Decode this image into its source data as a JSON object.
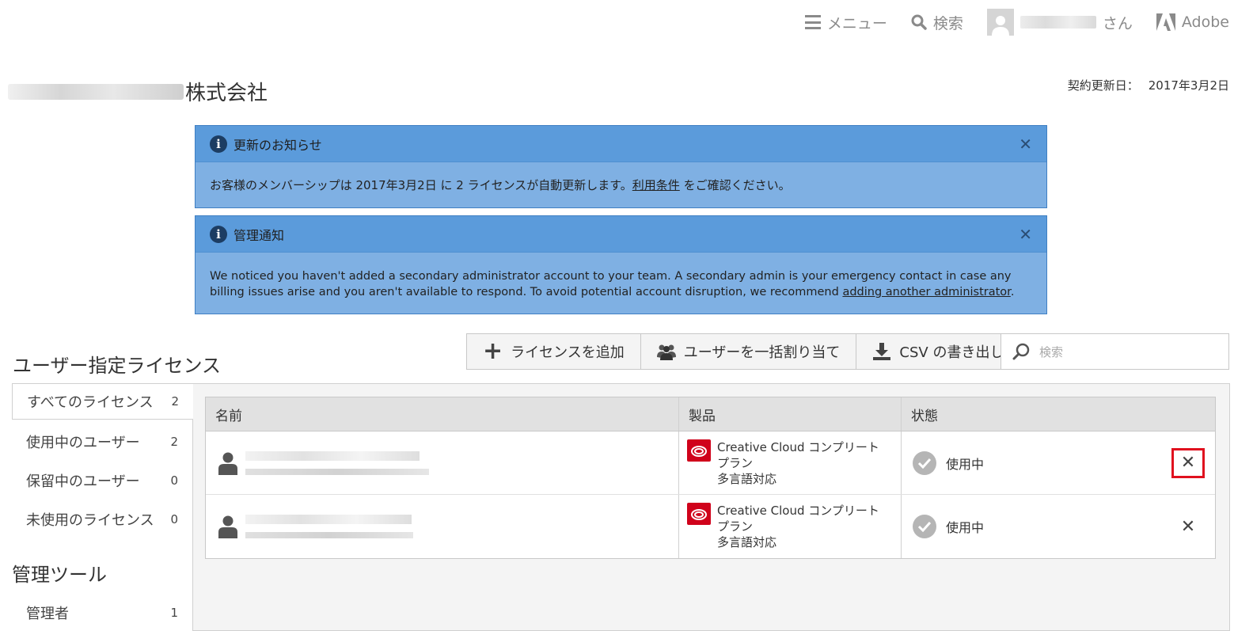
{
  "topnav": {
    "menu_label": "メニュー",
    "search_label": "検索",
    "user_suffix": "さん",
    "adobe_label": "Adobe"
  },
  "company": {
    "name_suffix": "株式会社",
    "renewal_label": "契約更新日：",
    "renewal_date": "2017年3月2日"
  },
  "notices": [
    {
      "title": "更新のお知らせ",
      "body_before": "お客様のメンバーシップは 2017年3月2日 に 2 ライセンスが自動更新します。",
      "link": "利用条件",
      "body_after": " をご確認ください。"
    },
    {
      "title": "管理通知",
      "body_before": "We noticed you haven't added a secondary administrator account to your team. A secondary admin is your emergency contact in case any billing issues arise and you aren't available to respond. To avoid potential account disruption, we recommend ",
      "link": "adding another administrator",
      "body_after": "."
    }
  ],
  "section": {
    "title": "ユーザー指定ライセンス",
    "add_license": "ライセンスを追加",
    "bulk_assign": "ユーザーを一括割り当て",
    "csv_export": "CSV の書き出し",
    "search_placeholder": "検索"
  },
  "sidebar": {
    "items": [
      {
        "label": "すべてのライセンス",
        "count": "2"
      },
      {
        "label": "使用中のユーザー",
        "count": "2"
      },
      {
        "label": "保留中のユーザー",
        "count": "0"
      },
      {
        "label": "未使用のライセンス",
        "count": "0"
      }
    ],
    "tools_title": "管理ツール",
    "tools": [
      {
        "label": "管理者",
        "count": "1"
      }
    ]
  },
  "table": {
    "headers": [
      "名前",
      "製品",
      "状態"
    ],
    "rows": [
      {
        "product_line1": "Creative Cloud コンプリートプラン",
        "product_line2": "多言語対応",
        "status": "使用中"
      },
      {
        "product_line1": "Creative Cloud コンプリートプラン",
        "product_line2": "多言語対応",
        "status": "使用中"
      }
    ]
  },
  "colors": {
    "notice_header": "#5b9bdb",
    "notice_body": "#7fb0e3",
    "highlight": "#e0101e",
    "cc_red": "#d0021b"
  }
}
